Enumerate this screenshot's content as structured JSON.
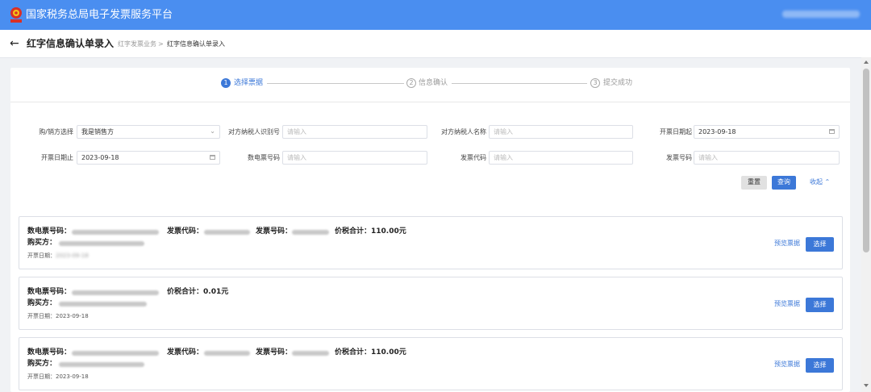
{
  "app": {
    "title": "国家税务总局电子发票服务平台",
    "accent_color": "#4a8ef0",
    "logo_icon": "tax-emblem-icon"
  },
  "header": {
    "back_icon": "←",
    "page_title": "红字信息确认单录入",
    "breadcrumb": [
      "红字发票业务",
      "红字信息确认单录入"
    ],
    "breadcrumb_sep": ">"
  },
  "steps": [
    {
      "num": "1",
      "label": "选择票据",
      "active": true
    },
    {
      "num": "2",
      "label": "信息确认",
      "active": false
    },
    {
      "num": "3",
      "label": "提交成功",
      "active": false
    }
  ],
  "filters": {
    "buyer_seller": {
      "label": "购/销方选择",
      "value": "我是销售方"
    },
    "counterparty_tax_id": {
      "label": "对方纳税人识别号",
      "placeholder": "请输入"
    },
    "counterparty_name": {
      "label": "对方纳税人名称",
      "placeholder": "请输入"
    },
    "date_from": {
      "label": "开票日期起",
      "value": "2023-09-18"
    },
    "date_to": {
      "label": "开票日期止",
      "value": "2023-09-18"
    },
    "e_invoice_no": {
      "label": "数电票号码",
      "placeholder": "请输入"
    },
    "invoice_code": {
      "label": "发票代码",
      "placeholder": "请输入"
    },
    "invoice_no": {
      "label": "发票号码",
      "placeholder": "请输入"
    }
  },
  "actions": {
    "reset": "重置",
    "query": "查询",
    "collapse": "收起"
  },
  "invoice_labels": {
    "e_invoice_no": "数电票号码：",
    "invoice_code": "发票代码：",
    "invoice_no": "发票号码：",
    "total_prefix": "价税合计：",
    "buyer": "购买方：",
    "issue_date": "开票日期："
  },
  "invoices": [
    {
      "total": "110.00元",
      "date": "2023-09-18",
      "preview": "预览票据",
      "select": "选择"
    },
    {
      "total": "0.01元",
      "date": "2023-09-18",
      "preview": "预览票据",
      "select": "选择"
    },
    {
      "total": "110.00元",
      "date": "2023-09-18",
      "preview": "预览票据",
      "select": "选择"
    }
  ]
}
